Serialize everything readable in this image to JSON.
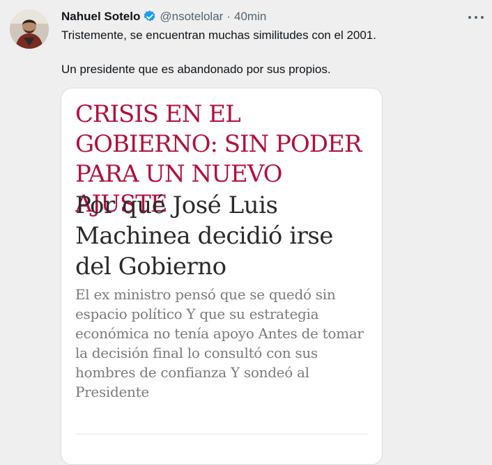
{
  "author": {
    "name": "Nahuel Sotelo",
    "handle": "@nsotelolar",
    "separator": "·",
    "time": "40min"
  },
  "tweet": {
    "line1": "Tristemente, se encuentran muchas similitudes con el 2001.",
    "line2": "Un presidente que es abandonado por sus propios."
  },
  "article": {
    "kicker": "CRISIS EN EL GOBIERNO: SIN PODER PARA UN NUEVO AJUSTE",
    "headline": "Por qué José Luis Machinea decidió irse del Gobierno",
    "dek": "El ex ministro pensó que se quedó sin espacio político Y que su estrategia económica no tenía apoyo Antes de tomar la decisión final lo consultó con sus hombres de confianza Y sondeó al Presidente"
  },
  "colors": {
    "background": "#efefef",
    "verified": "#1d9bf0",
    "kicker": "#b0103d",
    "secondary_text": "#536471"
  },
  "icons": [
    "verified-badge-icon",
    "more-options-icon"
  ]
}
